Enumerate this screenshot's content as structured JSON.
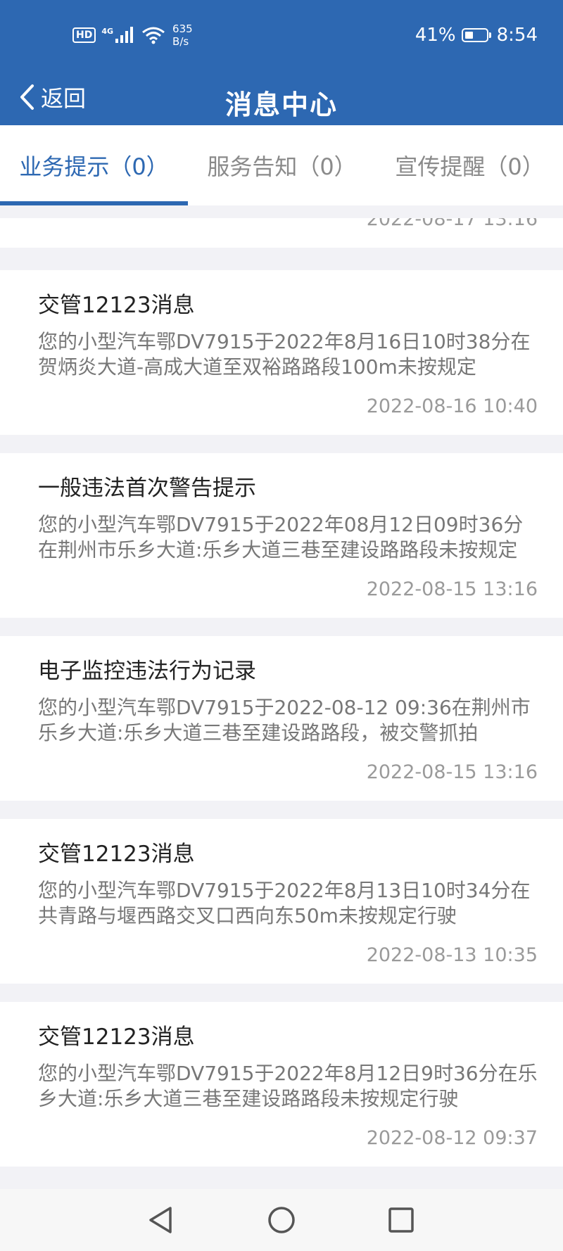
{
  "status_bar": {
    "hd": "HD",
    "network": "4G",
    "net_speed_value": "635",
    "net_speed_unit": "B/s",
    "battery_percent": "41%",
    "battery_level": 0.41,
    "time": "8:54"
  },
  "nav": {
    "back_label": "返回",
    "title": "消息中心"
  },
  "tabs": [
    {
      "label": "业务提示（0）",
      "active": true
    },
    {
      "label": "服务告知（0）",
      "active": false
    },
    {
      "label": "宣传提醒（0）",
      "active": false
    }
  ],
  "partial_message": {
    "time": "2022-08-17 13:16"
  },
  "messages": [
    {
      "title": "交管12123消息",
      "body": "您的小型汽车鄂DV7915于2022年8月16日10时38分在贺炳炎大道-高成大道至双裕路路段100m未按规定",
      "time": "2022-08-16 10:40"
    },
    {
      "title": "一般违法首次警告提示",
      "body": "您的小型汽车鄂DV7915于2022年08月12日09时36分在荆州市乐乡大道:乐乡大道三巷至建设路路段未按规定",
      "time": "2022-08-15 13:16"
    },
    {
      "title": "电子监控违法行为记录",
      "body": "您的小型汽车鄂DV7915于2022-08-12 09:36在荆州市乐乡大道:乐乡大道三巷至建设路路段，被交警抓拍",
      "time": "2022-08-15 13:16"
    },
    {
      "title": "交管12123消息",
      "body": "您的小型汽车鄂DV7915于2022年8月13日10时34分在共青路与堰西路交叉口西向东50m未按规定行驶",
      "time": "2022-08-13 10:35"
    },
    {
      "title": "交管12123消息",
      "body": "您的小型汽车鄂DV7915于2022年8月12日9时36分在乐乡大道:乐乡大道三巷至建设路路段未按规定行驶",
      "time": "2022-08-12 09:37"
    }
  ]
}
